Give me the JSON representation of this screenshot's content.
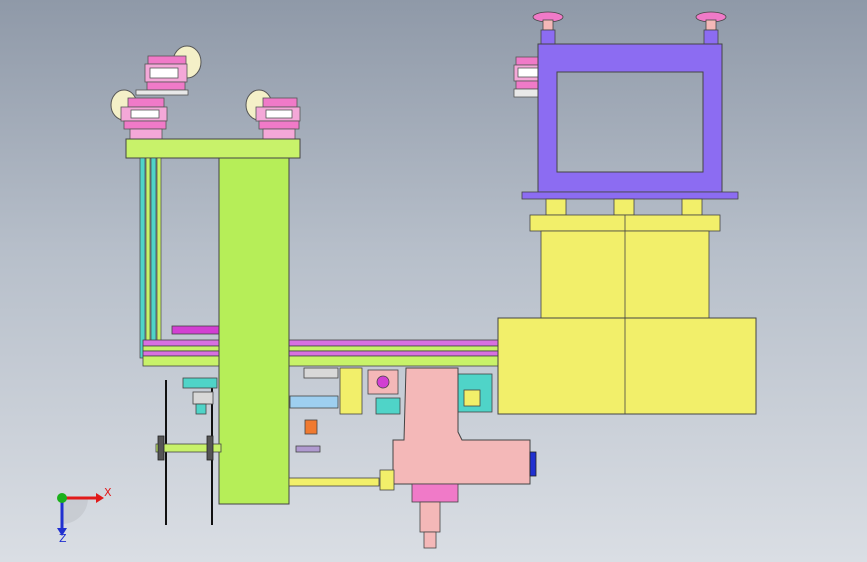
{
  "viewport": {
    "background_top": "#8f99a8",
    "background_bottom": "#dadee4"
  },
  "triad": {
    "x_label": "X",
    "z_label": "Z",
    "x_color": "#e11a1a",
    "y_color": "#1bb01b",
    "z_color": "#2030d0"
  },
  "colors": {
    "frame_green": "#c8f26a",
    "column_green": "#b6ee58",
    "purple_frame": "#8c6cf2",
    "yellow_cylinder": "#f2ef6a",
    "pink_block": "#f4b8b8",
    "magenta_rod": "#d23fd2",
    "pink_motor": "#f07ac8",
    "cream_wheel": "#f4f0c8",
    "cyan_rail": "#4fd4c8",
    "navy": "#1d2a8a"
  },
  "components": [
    "motor-1",
    "motor-2",
    "motor-3",
    "motor-4",
    "top-plate",
    "vertical-column",
    "cross-beam",
    "purple-frame",
    "yellow-cylinder-upper",
    "yellow-cylinder-lower",
    "pink-block",
    "lower-cylinder",
    "wheel-assembly",
    "yellow-rod"
  ]
}
